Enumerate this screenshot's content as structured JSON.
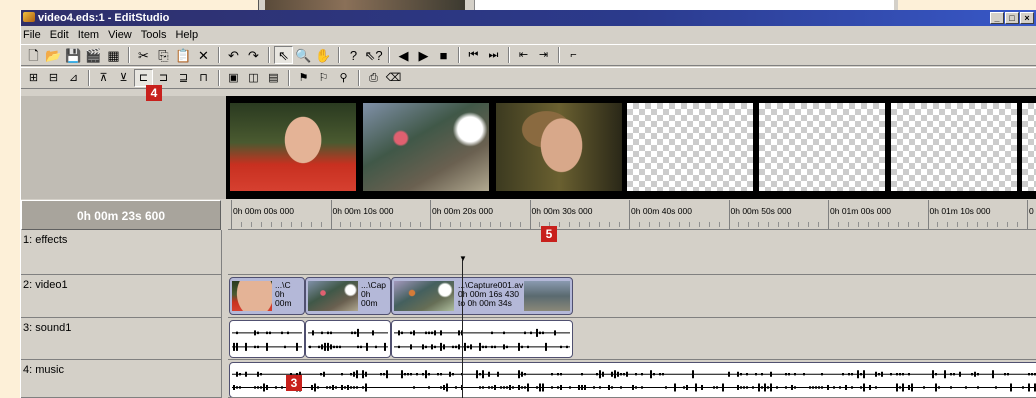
{
  "window": {
    "title": "video4.eds:1 - EditStudio",
    "controls": [
      "_",
      "□",
      "×"
    ]
  },
  "menu": [
    "File",
    "Edit",
    "Item",
    "View",
    "Tools",
    "Help"
  ],
  "toolbar1_icons": [
    "new-icon",
    "open-icon",
    "save-icon",
    "clip-icon",
    "render-icon",
    "cut-icon",
    "copy-icon",
    "paste-icon",
    "delete-icon",
    "undo-icon",
    "redo-icon",
    "pointer-icon",
    "zoom-icon",
    "hand-icon",
    "help-icon",
    "context-help-icon",
    "play-reverse-icon",
    "play-icon",
    "stop-icon",
    "step-back-icon",
    "step-forward-icon",
    "prev-edit-icon",
    "next-edit-icon",
    "marker-icon"
  ],
  "callouts": {
    "c4": "4",
    "c5": "5",
    "c3": "3"
  },
  "timeline": {
    "current_time": "0h 00m 23s 600",
    "ruler_labels": [
      "0h 00m 00s 000",
      "0h 00m 10s 000",
      "0h 00m 20s 000",
      "0h 00m 30s 000",
      "0h 00m 40s 000",
      "0h 00m 50s 000",
      "0h 01m 00s 000",
      "0h 01m 10s 000",
      "0"
    ],
    "playhead_time_seconds": 23.6,
    "tracks": [
      {
        "label": "1: effects"
      },
      {
        "label": "2: video1"
      },
      {
        "label": "3: sound1"
      },
      {
        "label": "4: music"
      }
    ],
    "clips": [
      {
        "text": "...\\C\n0h\n00m"
      },
      {
        "text": "...\\Cap\n0h\n00m"
      },
      {
        "text": "...\\Capture001.av\n0h 00m 16s 430\nto 0h 00m 34s"
      }
    ]
  },
  "colors": {
    "accent": "#c8201c",
    "titlebar": "#2b3a8c",
    "clip": "#b4b8d8"
  }
}
